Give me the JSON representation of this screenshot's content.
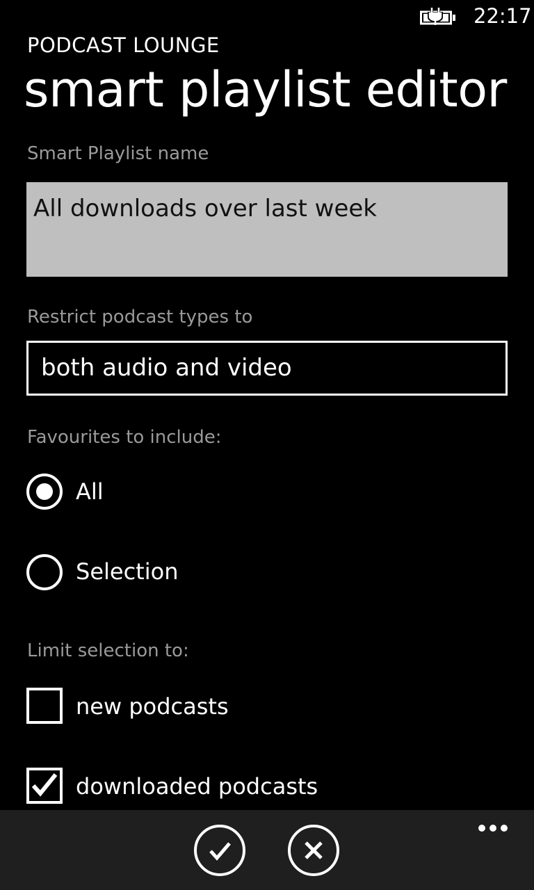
{
  "status_bar": {
    "time": "22:17",
    "battery_icon": "battery-charging-icon"
  },
  "header": {
    "app_name": "PODCAST LOUNGE",
    "title": "smart playlist editor"
  },
  "form": {
    "name_label": "Smart Playlist name",
    "name_value": "All downloads over last week",
    "type_label": "Restrict podcast types to",
    "type_value": "both audio and video",
    "favourites_label": "Favourites to include:",
    "favourites_options": [
      {
        "label": "All",
        "selected": true
      },
      {
        "label": "Selection",
        "selected": false
      }
    ],
    "limit_label": "Limit selection to:",
    "limit_options": [
      {
        "label": "new podcasts",
        "checked": false
      },
      {
        "label": "downloaded podcasts",
        "checked": true
      }
    ]
  },
  "app_bar": {
    "buttons": [
      {
        "icon": "check-icon"
      },
      {
        "icon": "cancel-icon"
      }
    ],
    "more_icon": "ellipsis-icon",
    "background": "#1f1f1f"
  }
}
